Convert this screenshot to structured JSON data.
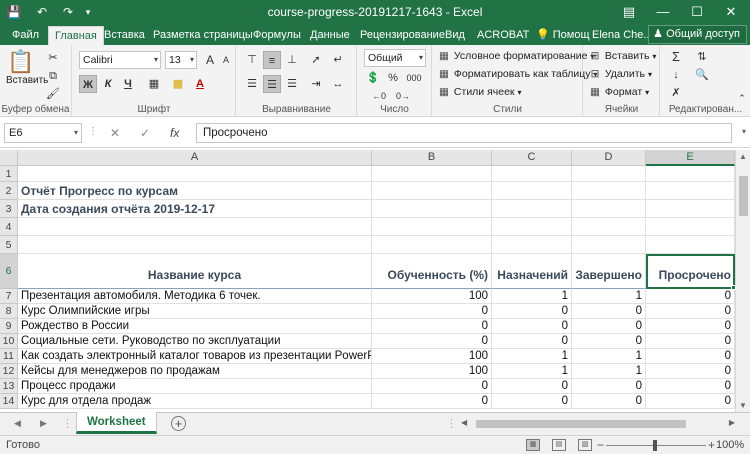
{
  "window": {
    "title": "course-progress-20191217-1643 - Excel",
    "icons": [
      "save-icon",
      "undo-icon",
      "redo-icon",
      "customize-qat-icon",
      "ribbon-display-icon",
      "minimize-icon",
      "maximize-icon",
      "close-icon"
    ]
  },
  "ribbon_tabs": {
    "file": "Файл",
    "home": "Главная",
    "insert": "Вставка",
    "layout": "Разметка страницы",
    "formulas": "Формулы",
    "data": "Данные",
    "review": "Рецензирование",
    "view": "Вид",
    "acrobat": "ACROBAT",
    "tell_me": "Помощ",
    "user": "Elena Che...",
    "share": "Общий доступ"
  },
  "ribbon": {
    "clipboard": {
      "paste": "Вставить",
      "label": "Буфер обмена"
    },
    "font": {
      "name": "Calibri",
      "size": "13",
      "label": "Шрифт",
      "bold": "Ж",
      "italic": "К",
      "underline": "Ч",
      "grow": "A",
      "shrink": "A"
    },
    "alignment": {
      "label": "Выравнивание"
    },
    "number": {
      "format": "Общий",
      "label": "Число",
      "percent": "%",
      "thousands": "000"
    },
    "styles": {
      "conditional": "Условное форматирование",
      "as_table": "Форматировать как таблицу",
      "cell_styles": "Стили ячеек",
      "label": "Стили"
    },
    "cells": {
      "insert": "Вставить",
      "delete": "Удалить",
      "format": "Формат",
      "label": "Ячейки"
    },
    "editing": {
      "label": "Редактирован..."
    }
  },
  "formula_bar": {
    "name_box": "E6",
    "fx": "fx",
    "content": "Просрочено"
  },
  "grid": {
    "columns": [
      "A",
      "B",
      "C",
      "D",
      "E"
    ],
    "selected_column": "E",
    "selected_row": "6",
    "row_numbers": [
      "1",
      "2",
      "3",
      "4",
      "5",
      "6",
      "7",
      "8",
      "9",
      "10",
      "11",
      "12",
      "13",
      "14"
    ],
    "report_title": "Отчёт Прогресс по курсам",
    "report_date": "Дата создания отчёта 2019-12-17",
    "headers": [
      "Название курса",
      "Обученность (%)",
      "Назначений",
      "Завершено",
      "Просрочено"
    ],
    "rows": [
      [
        "Презентация автомобиля. Методика 6 точек.",
        "100",
        "1",
        "1",
        "0"
      ],
      [
        "Курс Олимпийские игры",
        "0",
        "0",
        "0",
        "0"
      ],
      [
        "Рождество в России",
        "0",
        "0",
        "0",
        "0"
      ],
      [
        "Социальные сети. Руководство по эксплуатации",
        "0",
        "0",
        "0",
        "0"
      ],
      [
        "Как создать электронный каталог товаров из презентации PowerPoint",
        "100",
        "1",
        "1",
        "0"
      ],
      [
        "Кейсы для менеджеров по продажам",
        "100",
        "1",
        "1",
        "0"
      ],
      [
        "Процесс продажи",
        "0",
        "0",
        "0",
        "0"
      ],
      [
        "Курс для отдела продаж",
        "0",
        "0",
        "0",
        "0"
      ]
    ]
  },
  "sheet_tabs": {
    "active": "Worksheet",
    "add": "+"
  },
  "status_bar": {
    "status": "Готово",
    "zoom_minus": "−",
    "zoom_plus": "+",
    "zoom": "100%"
  }
}
